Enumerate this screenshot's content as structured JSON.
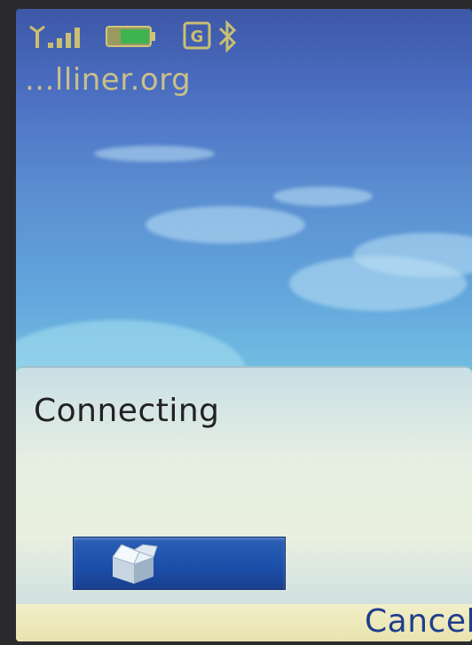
{
  "status_bar": {
    "signal_icon": "signal-strength-icon",
    "battery_icon": "battery-icon",
    "data_icon": "gprs-icon",
    "bluetooth_icon": "bluetooth-icon"
  },
  "header": {
    "url": "...lliner.org"
  },
  "dialog": {
    "title": "Connecting",
    "progress_icon": "package-box-icon"
  },
  "softkeys": {
    "right": "Cancel"
  },
  "colors": {
    "url_text": "#c9c08a",
    "dialog_text": "#222222",
    "progress_bar": "#1b4ea8",
    "softkey_text": "#1f3e8c"
  }
}
